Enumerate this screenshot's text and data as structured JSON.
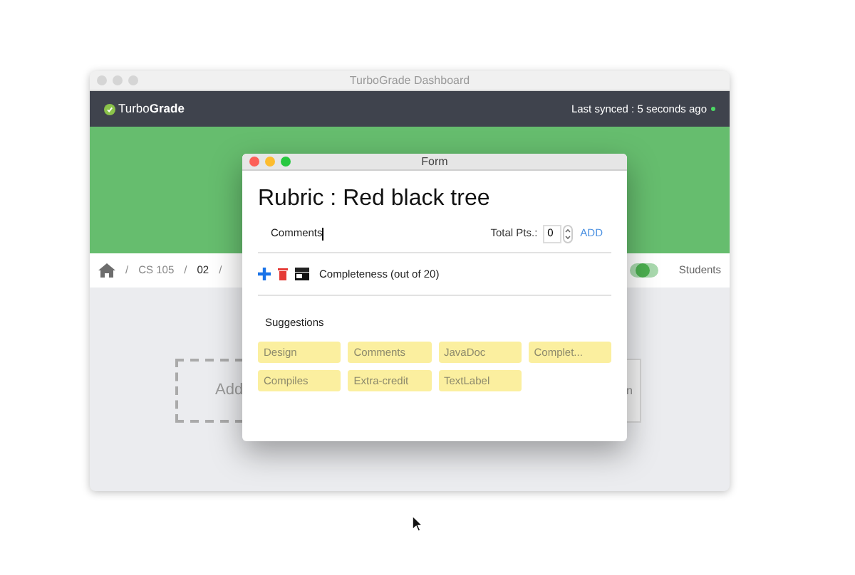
{
  "window": {
    "title": "TurboGrade Dashboard"
  },
  "header": {
    "brand": "Turbo**Grade**",
    "sync_status": "Last synced : 5 seconds ago",
    "online": true
  },
  "breadcrumb": {
    "separator": "/",
    "items": [
      "CS 105",
      "02"
    ]
  },
  "students_toggle": {
    "on": true,
    "label": "Students"
  },
  "content": {
    "add_card": "Add",
    "card_text": "n"
  },
  "form": {
    "title": "Form",
    "heading": "Rubric : Red black tree",
    "comment_value": "Comments",
    "total_label": "Total Pts.:",
    "total_value": "0",
    "add_link": "ADD",
    "criteria": [
      {
        "label": "Completeness (out of 20)"
      }
    ],
    "suggestions_title": "Suggestions",
    "suggestions": [
      "Design",
      "Comments",
      "JavaDoc",
      "Complet...",
      "Compiles",
      "Extra-credit",
      "TextLabel"
    ]
  }
}
